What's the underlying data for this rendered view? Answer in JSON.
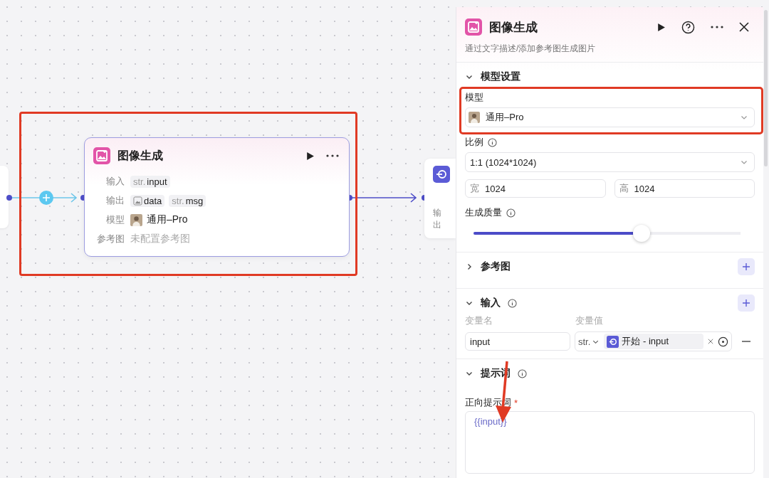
{
  "canvas": {
    "node": {
      "title": "图像生成",
      "rows": [
        {
          "label": "输入",
          "values": [
            {
              "kind": "str",
              "type": "str.",
              "text": "input"
            }
          ]
        },
        {
          "label": "输出",
          "values": [
            {
              "kind": "image",
              "text": "data"
            },
            {
              "kind": "str",
              "type": "str.",
              "text": "msg"
            }
          ]
        },
        {
          "label": "模型",
          "values": [
            {
              "kind": "model",
              "text": "通用–Pro"
            }
          ]
        },
        {
          "label": "参考图",
          "values": [
            {
              "kind": "empty",
              "text": "未配置参考图"
            }
          ]
        }
      ]
    },
    "next_node": {
      "label": "输出"
    }
  },
  "panel": {
    "title": "图像生成",
    "description": "通过文字描述/添加参考图生成图片",
    "sections": [
      {
        "kind": "model",
        "title": "模型设置",
        "expanded": true,
        "model_label": "模型",
        "model_value": "通用–Pro",
        "ratio_label": "比例",
        "ratio_value": "1:1 (1024*1024)",
        "width_label": "宽",
        "width_value": "1024",
        "height_label": "高",
        "height_value": "1024",
        "quality": {
          "label": "生成质量",
          "level": 0.63
        }
      },
      {
        "kind": "reference",
        "title": "参考图",
        "expanded": false
      },
      {
        "kind": "inputs",
        "title": "输入",
        "expanded": true,
        "columns": [
          "变量名",
          "变量值"
        ],
        "rows": [
          {
            "name": "input",
            "type": "str.",
            "source": "开始 - input"
          }
        ]
      },
      {
        "kind": "prompt",
        "title": "提示词",
        "expanded": true,
        "label": "正向提示词",
        "required_mark": "*",
        "value": "{{input}}"
      }
    ]
  }
}
